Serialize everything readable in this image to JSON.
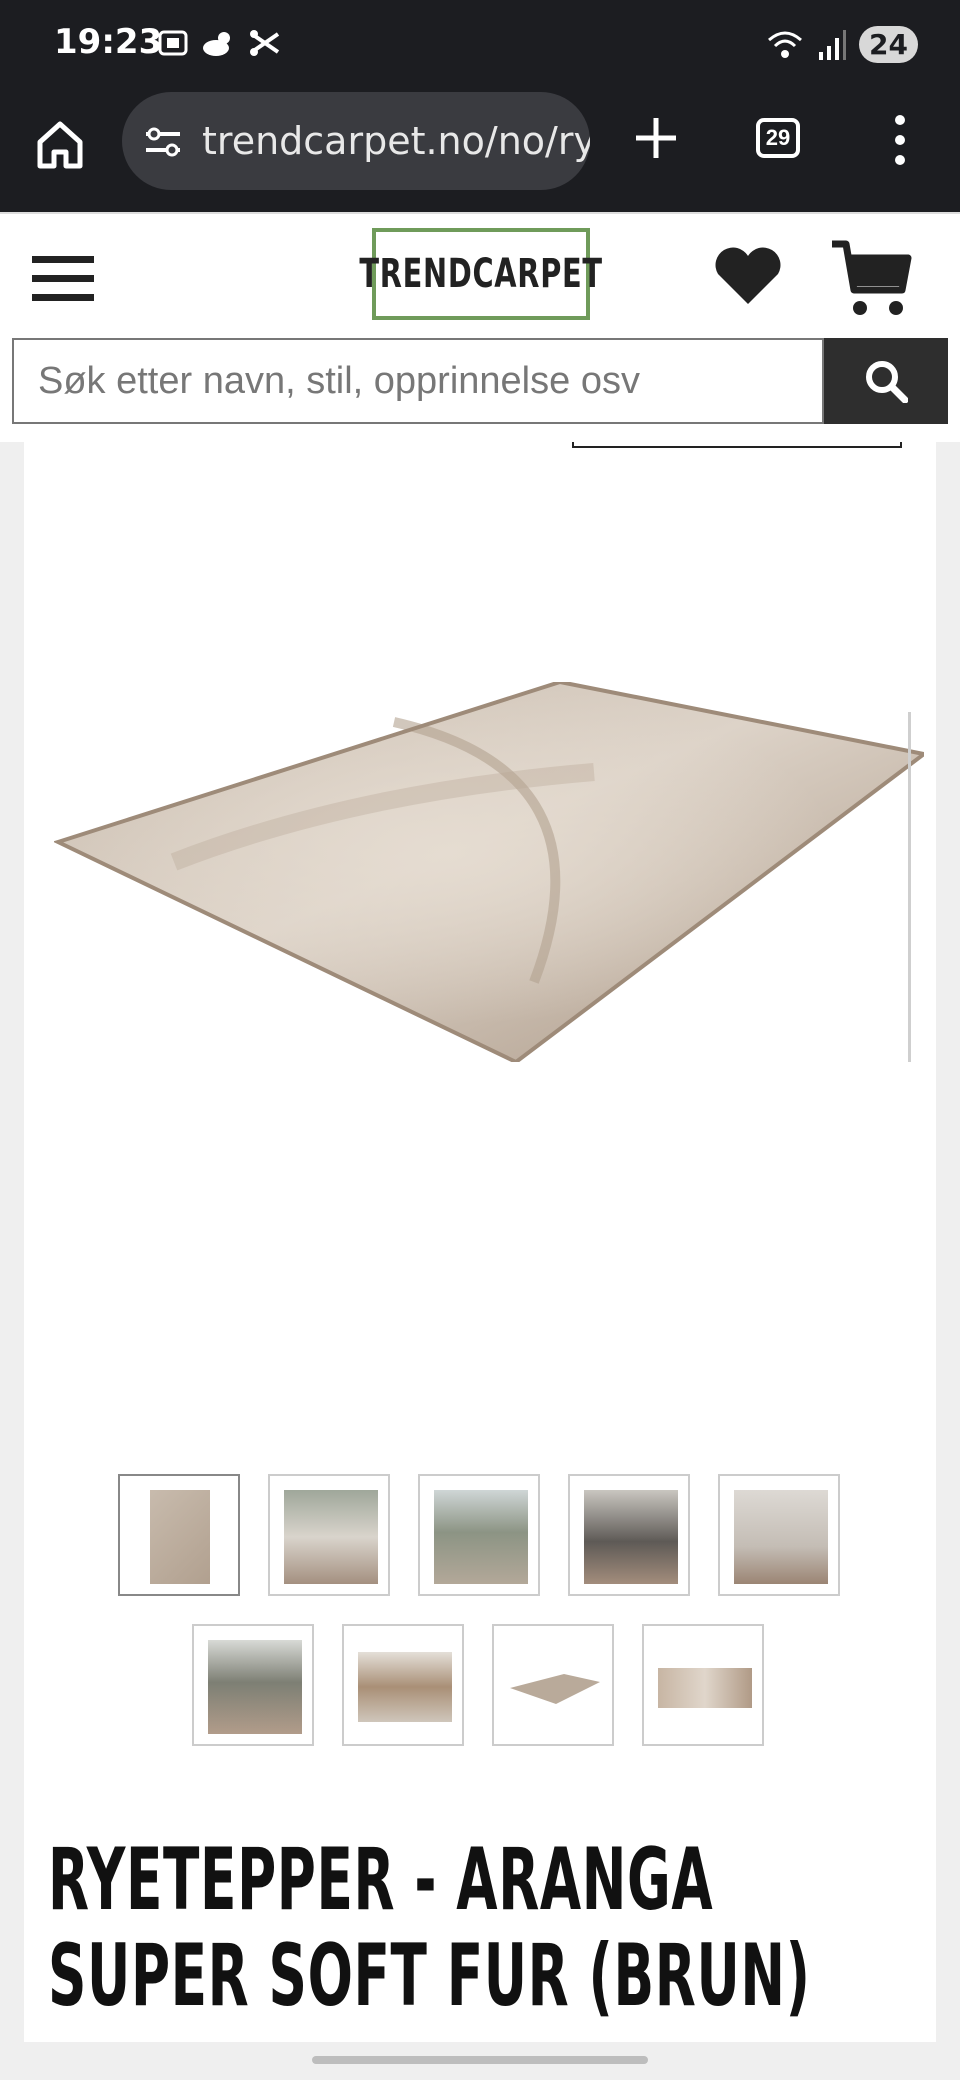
{
  "status_bar": {
    "time": "19:23",
    "left_icons": [
      "screenshot-icon",
      "weather-icon",
      "scissors-icon"
    ],
    "right_icons": [
      "wifi-icon",
      "signal-icon"
    ],
    "battery": "24"
  },
  "browser": {
    "url": "trendcarpet.no/no/ry",
    "tab_count": "29"
  },
  "header": {
    "logo_text": "TRENDCARPET",
    "logo_color": "#6f9b5a"
  },
  "search": {
    "placeholder": "Søk etter navn, stil, opprinnelse osv"
  },
  "product": {
    "title": "RYETEPPER - ARANGA SUPER SOFT FUR (BRUN)",
    "thumbnails": [
      {
        "name": "thumb-rug-top"
      },
      {
        "name": "thumb-living-room-1"
      },
      {
        "name": "thumb-living-room-2"
      },
      {
        "name": "thumb-living-room-3"
      },
      {
        "name": "thumb-living-room-4"
      },
      {
        "name": "thumb-living-room-5"
      },
      {
        "name": "thumb-living-room-6"
      },
      {
        "name": "thumb-rug-angle"
      },
      {
        "name": "thumb-rug-closeup"
      }
    ]
  }
}
